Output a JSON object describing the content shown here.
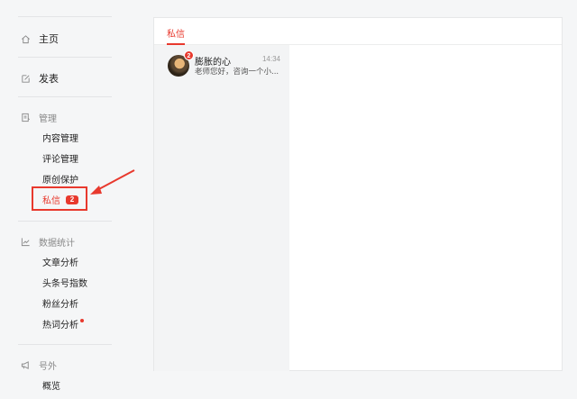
{
  "sidebar": {
    "home_label": "主页",
    "publish_label": "发表",
    "manage": {
      "group_label": "管理",
      "items": [
        "内容管理",
        "评论管理",
        "原创保护"
      ],
      "messages_label": "私信",
      "messages_badge": "2"
    },
    "stats": {
      "group_label": "数据统计",
      "items": [
        "文章分析",
        "头条号指数",
        "粉丝分析"
      ],
      "hotwords_label": "热词分析"
    },
    "extra": {
      "group_label": "号外",
      "items": [
        "概览"
      ]
    }
  },
  "main": {
    "tab_label": "私信",
    "conversations": [
      {
        "name": "膨胀的心",
        "time": "14:34",
        "preview": "老师您好，咨询一个小...",
        "unread": "2"
      }
    ]
  },
  "colors": {
    "accent": "#e8392d",
    "background": "#f5f6f7",
    "panel": "#ffffff"
  },
  "icons": {
    "home": "home-icon",
    "publish": "edit-icon",
    "manage": "document-icon",
    "stats": "chart-icon",
    "extra": "megaphone-icon"
  }
}
